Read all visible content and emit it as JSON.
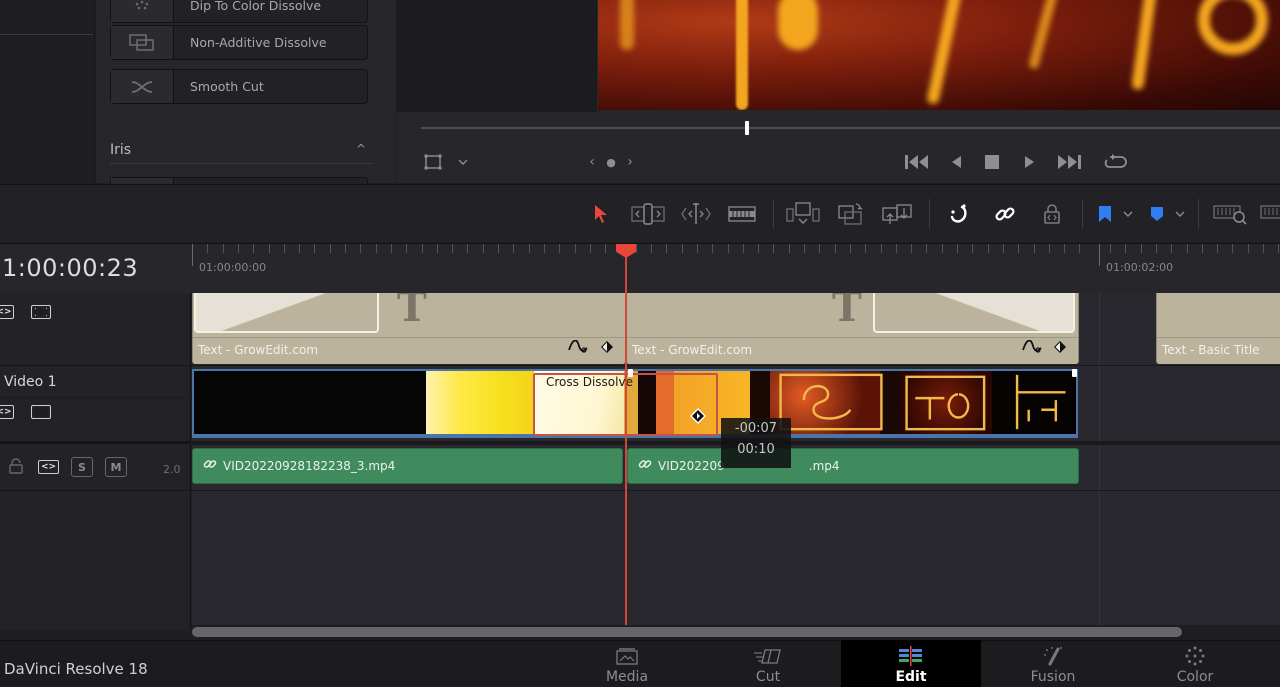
{
  "app": {
    "name": "DaVinci Resolve 18"
  },
  "effects_panel": {
    "items": [
      {
        "label": "Dip To Color Dissolve",
        "icon": "dip-to-color-dissolve-icon"
      },
      {
        "label": "Non-Additive Dissolve",
        "icon": "non-additive-dissolve-icon"
      },
      {
        "label": "Smooth Cut",
        "icon": "smooth-cut-icon"
      }
    ],
    "section_header": "Iris",
    "section_collapse_glyph": "^"
  },
  "viewer": {
    "scrub_position": 0.38,
    "controls": {
      "transform_icon": "transform-icon",
      "nav_prev": "‹",
      "nav_dot": "●",
      "nav_next": "›",
      "playback": [
        "go-to-start",
        "reverse-play",
        "stop",
        "play",
        "go-to-end",
        "loop"
      ]
    }
  },
  "toolbar": {
    "tools": [
      "selection-mode",
      "trim-edit-mode",
      "dynamic-trim-mode",
      "blade-edit-mode",
      "insert-clip",
      "overwrite-clip",
      "replace-clip",
      "snapping",
      "linked-selection",
      "position-lock",
      "flag",
      "marker",
      "zoom-to-fit",
      "custom-zoom"
    ],
    "colors": {
      "selection_active": "#e8473a",
      "flag": "#2f7ff0",
      "marker": "#2f7ff0"
    }
  },
  "timeline": {
    "current_timecode": "1:00:00:23",
    "ruler_labels": [
      "01:00:00:00",
      "01:00:02:00"
    ],
    "tracks": {
      "video2": {
        "clips": [
          {
            "name": "Text - GrowEdit.com"
          },
          {
            "name": "Text - GrowEdit.com"
          },
          {
            "name": "Text - Basic Title"
          }
        ]
      },
      "video1": {
        "name": "Video 1",
        "transition": "Cross Dissolve"
      },
      "audio1": {
        "buttons": [
          "S",
          "M"
        ],
        "level": "2.0",
        "clips": [
          {
            "name": "VID20220928182238_3.mp4"
          },
          {
            "name_visible_prefix": "VID202209",
            "name_visible_suffix": ".mp4"
          }
        ]
      }
    },
    "trim_tooltip": {
      "delta": "-00:07",
      "duration": "00:10"
    },
    "playhead_color": "#e8473a"
  },
  "page_tabs": [
    {
      "label": "Media",
      "icon": "media-page-icon",
      "active": false
    },
    {
      "label": "Cut",
      "icon": "cut-page-icon",
      "active": false
    },
    {
      "label": "Edit",
      "icon": "edit-page-icon",
      "active": true
    },
    {
      "label": "Fusion",
      "icon": "fusion-page-icon",
      "active": false
    },
    {
      "label": "Color",
      "icon": "color-page-icon",
      "active": false
    }
  ]
}
